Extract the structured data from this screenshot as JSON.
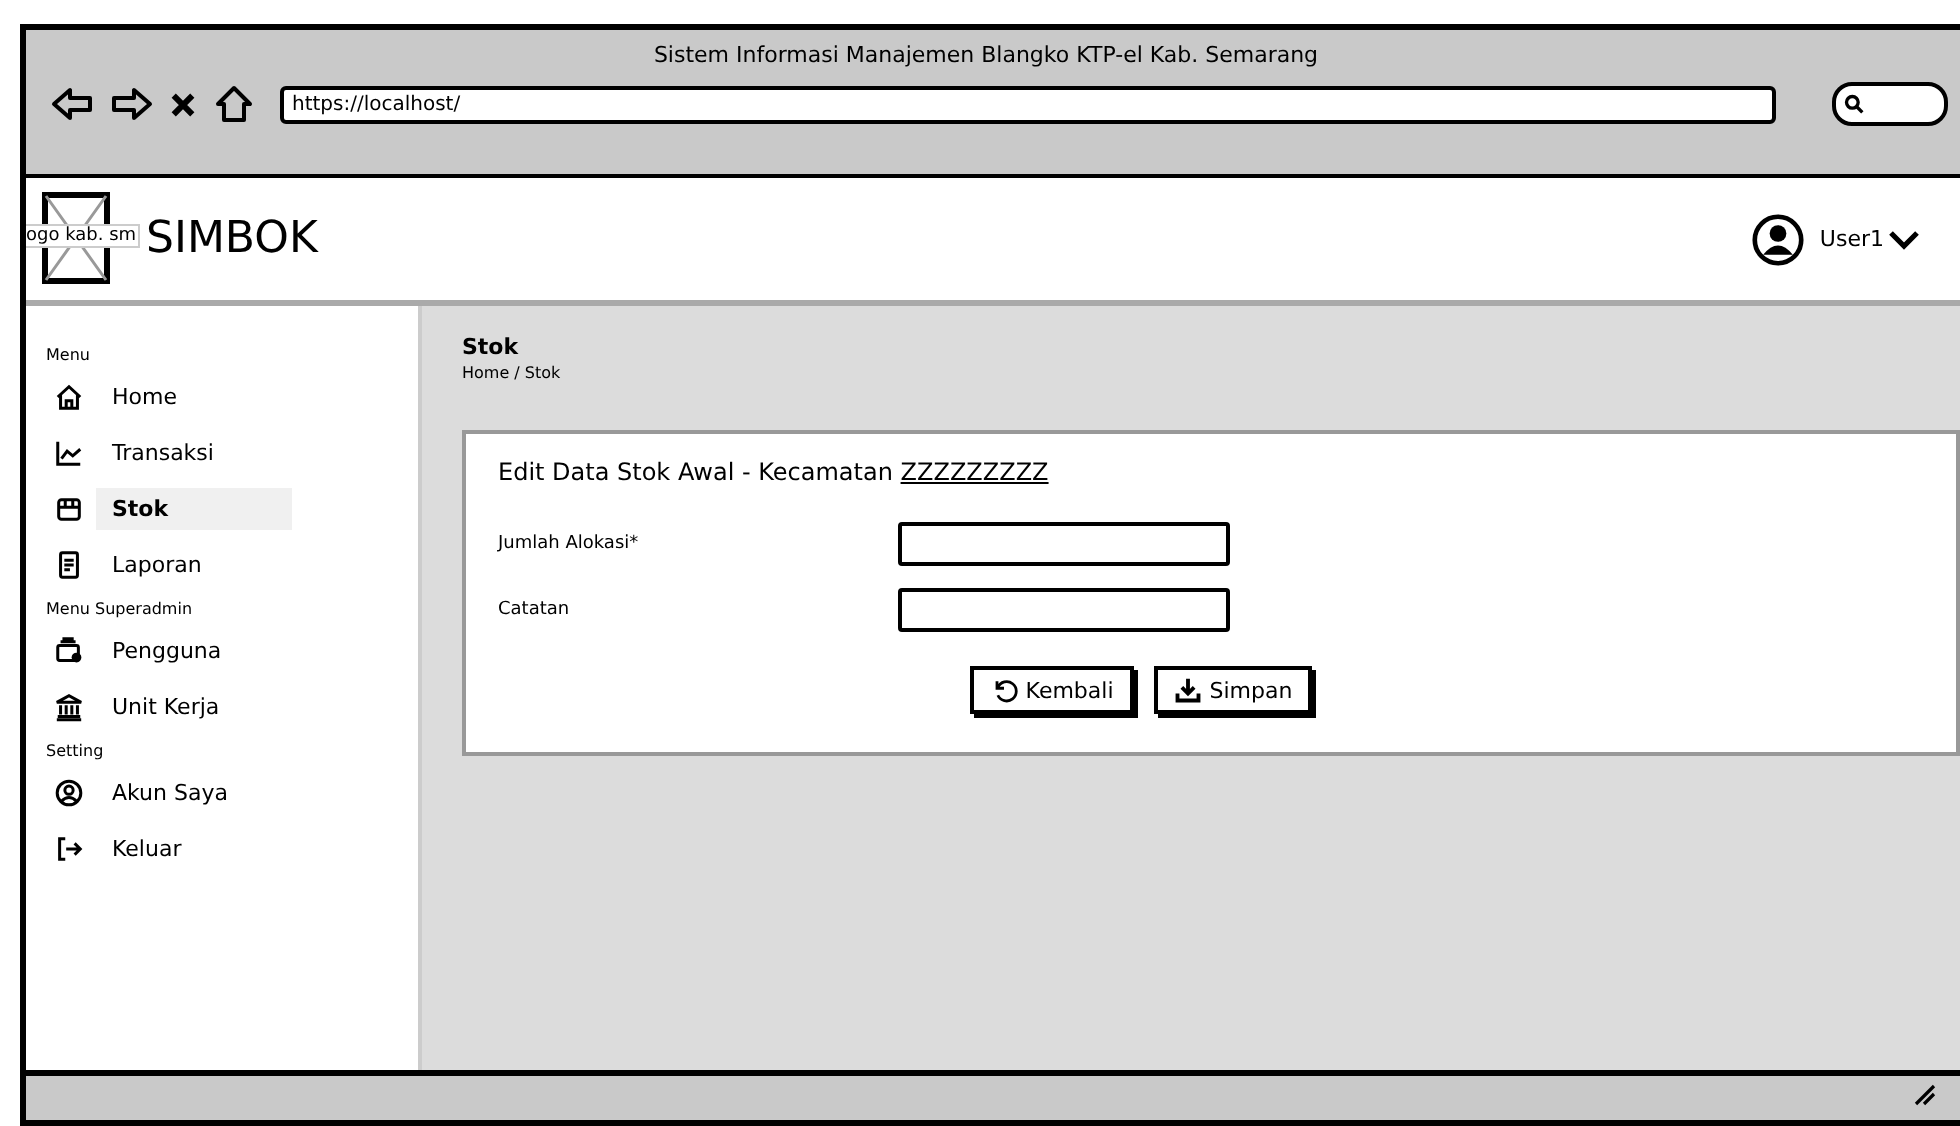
{
  "window": {
    "title": "Sistem Informasi Manajemen Blangko KTP-el Kab. Semarang",
    "address": "https://localhost/"
  },
  "header": {
    "logo_label": "ogo kab. sm",
    "app_name": "SIMBOK",
    "user": "User1"
  },
  "sidebar": {
    "sections": [
      {
        "title": "Menu",
        "items": [
          {
            "label": "Home",
            "selected": false
          },
          {
            "label": "Transaksi",
            "selected": false
          },
          {
            "label": "Stok",
            "selected": true
          },
          {
            "label": "Laporan",
            "selected": false
          }
        ]
      },
      {
        "title": "Menu Superadmin",
        "items": [
          {
            "label": "Pengguna",
            "selected": false
          },
          {
            "label": "Unit Kerja",
            "selected": false
          }
        ]
      },
      {
        "title": "Setting",
        "items": [
          {
            "label": "Akun Saya",
            "selected": false
          },
          {
            "label": "Keluar",
            "selected": false
          }
        ]
      }
    ]
  },
  "page": {
    "title": "Stok",
    "breadcrumb": "Home / Stok"
  },
  "form": {
    "title": "Edit Data Stok Awal - Kecamatan",
    "title_link": "ZZZZZZZZZ",
    "fields": [
      {
        "label": "Jumlah Alokasi*"
      },
      {
        "label": "Catatan"
      }
    ],
    "buttons": [
      {
        "label": "Kembali",
        "kind": "back"
      },
      {
        "label": "Simpan",
        "kind": "save"
      }
    ]
  }
}
